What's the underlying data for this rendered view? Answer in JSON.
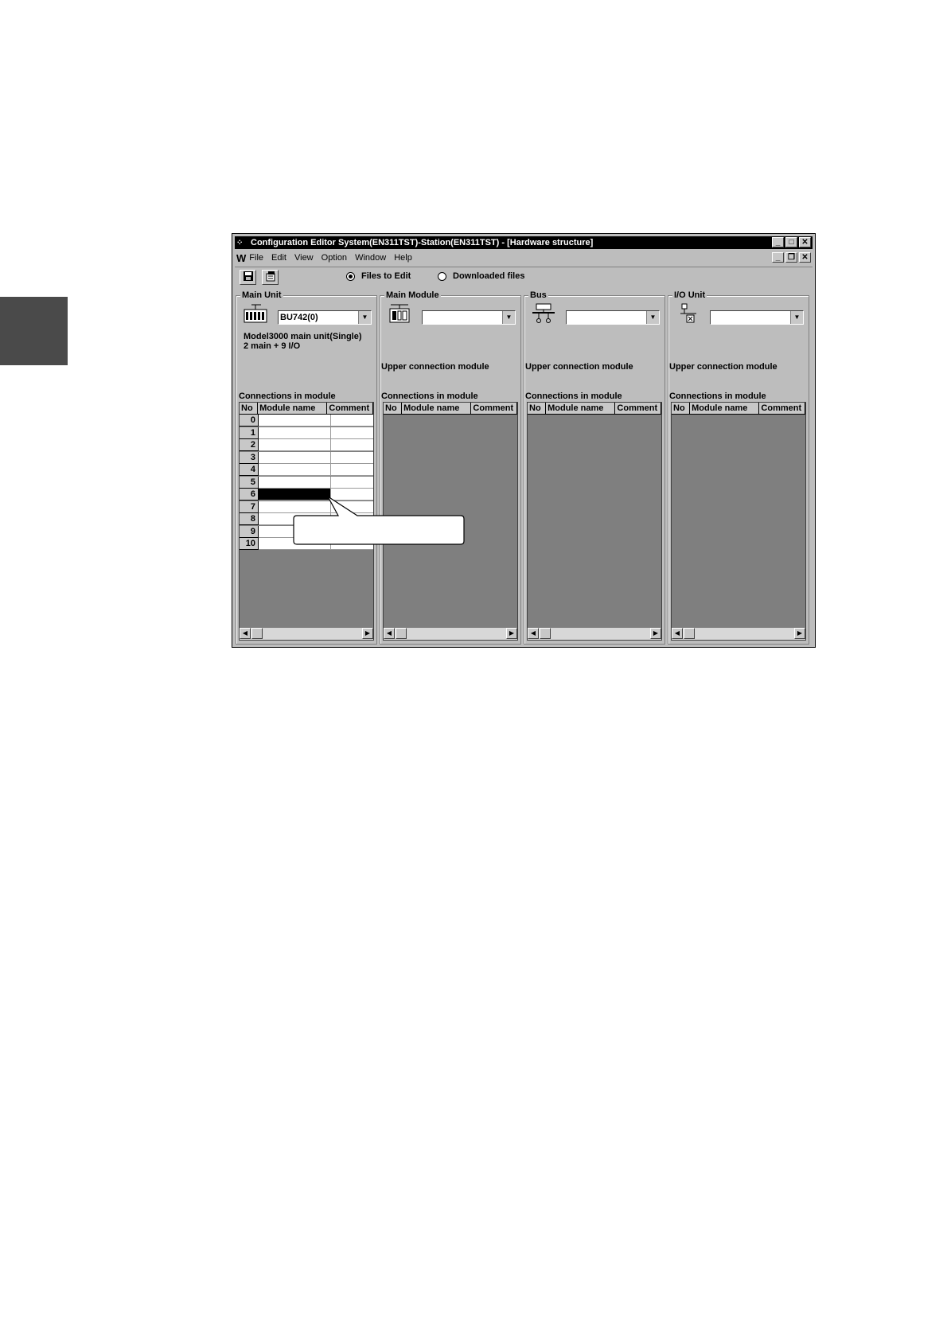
{
  "window": {
    "title": "Configuration Editor  System(EN311TST)-Station(EN311TST)    - [Hardware structure]",
    "buttons": [
      "_",
      "□",
      "✕"
    ],
    "mdi_buttons": [
      "_",
      "❐",
      "✕"
    ]
  },
  "menu": {
    "items": [
      "File",
      "Edit",
      "View",
      "Option",
      "Window",
      "Help"
    ]
  },
  "toolbar": {
    "radio_files_to_edit": "Files to Edit",
    "radio_downloaded_files": "Downloaded files",
    "selected": "Files to Edit"
  },
  "grid_headers": {
    "no": "No",
    "module_name": "Module name",
    "comment": "Comment"
  },
  "panels": [
    {
      "title": "Main Unit",
      "icon": "main-unit-icon",
      "combo_value": "BU742(0)",
      "description_line1": "Model3000 main unit(Single)",
      "description_line2": "2 main + 9 I/O",
      "connections_label": "Connections in module",
      "rows": [
        "0",
        "1",
        "2",
        "3",
        "4",
        "5",
        "6",
        "7",
        "8",
        "9",
        "10"
      ],
      "selected_row": "6"
    },
    {
      "title": "Main Module",
      "icon": "main-module-icon",
      "combo_value": "",
      "upper_label": "Upper connection module",
      "connections_label": "Connections in module"
    },
    {
      "title": "Bus",
      "icon": "bus-icon",
      "combo_value": "",
      "upper_label": "Upper connection module",
      "connections_label": "Connections in module"
    },
    {
      "title": "I/O Unit",
      "icon": "io-unit-icon",
      "combo_value": "",
      "upper_label": "Upper connection module",
      "connections_label": "Connections in module"
    }
  ]
}
